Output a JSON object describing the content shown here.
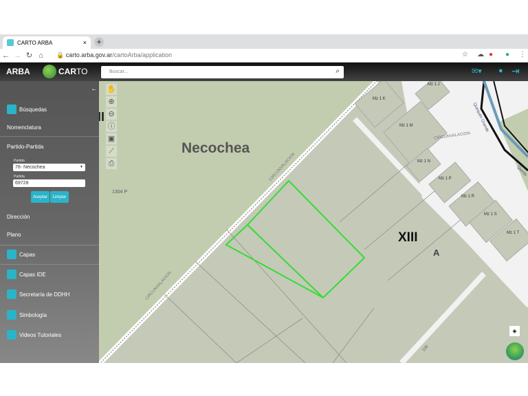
{
  "browser": {
    "tab_title": "CARTO ARBA",
    "url_host": "carto.arba.gov.ar",
    "url_path": "/cartoArba/application",
    "close": "×",
    "newtab": "+"
  },
  "header": {
    "brand": "ARBA",
    "carto_bold": "CAR",
    "carto_light": "TO",
    "search_placeholder": "Buscar..."
  },
  "sidebar": {
    "busquedas": "Búsquedas",
    "nomenclatura": "Nomenclatura",
    "partido_partida": "Partido-Partida",
    "partido_label": "Partido",
    "partido_value": "76- Necochea",
    "partida_label": "Partida",
    "partida_value": "69728",
    "aceptar": "Aceptar",
    "limpiar": "Limpiar",
    "direccion": "Dirección",
    "plano": "Plano",
    "capas": "Capas",
    "capas_ide": "Capas IDE",
    "secretaria": "Secretaría de DDHH",
    "simbologia": "Simbología",
    "videos": "Videos Tutoriales"
  },
  "map": {
    "city": "Necochea",
    "xii": "XII",
    "xiii": "XIII",
    "a": "A",
    "parcel_1304": "1304 P",
    "road1": "CIRCUNVALACION",
    "road2": "CIRCUNVALACION",
    "road3": "CIRCUNVALACION",
    "road_106": "106",
    "river": "Quequén Grande",
    "river2": "Quequ",
    "blocks": [
      "Mz 1 J",
      "Mz 1 K",
      "Mz 1 M",
      "Mz 1 N",
      "Mz 1 P",
      "Mz 1 R",
      "Mz 1 S",
      "Mz 1 T"
    ],
    "highlight_color": "#33dd33"
  }
}
